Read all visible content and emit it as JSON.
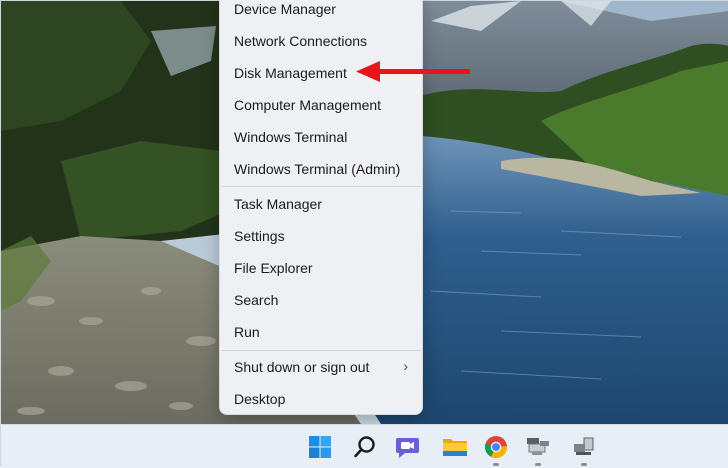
{
  "context_menu": {
    "items": [
      {
        "label": "Device Manager"
      },
      {
        "label": "Network Connections"
      },
      {
        "label": "Disk Management"
      },
      {
        "label": "Computer Management"
      },
      {
        "label": "Windows Terminal"
      },
      {
        "label": "Windows Terminal (Admin)"
      },
      {
        "label": "Task Manager"
      },
      {
        "label": "Settings"
      },
      {
        "label": "File Explorer"
      },
      {
        "label": "Search"
      },
      {
        "label": "Run"
      },
      {
        "label": "Shut down or sign out",
        "submenu_indicator": "›"
      },
      {
        "label": "Desktop"
      }
    ]
  },
  "annotations": {
    "arrow_color": "#e8141b"
  },
  "taskbar": {
    "icons": [
      "start-icon",
      "search-icon",
      "teams-chat-icon",
      "file-explorer-icon",
      "chrome-icon",
      "network-app-icon",
      "device-app-icon"
    ],
    "start_accent": "#1a8fe3"
  }
}
